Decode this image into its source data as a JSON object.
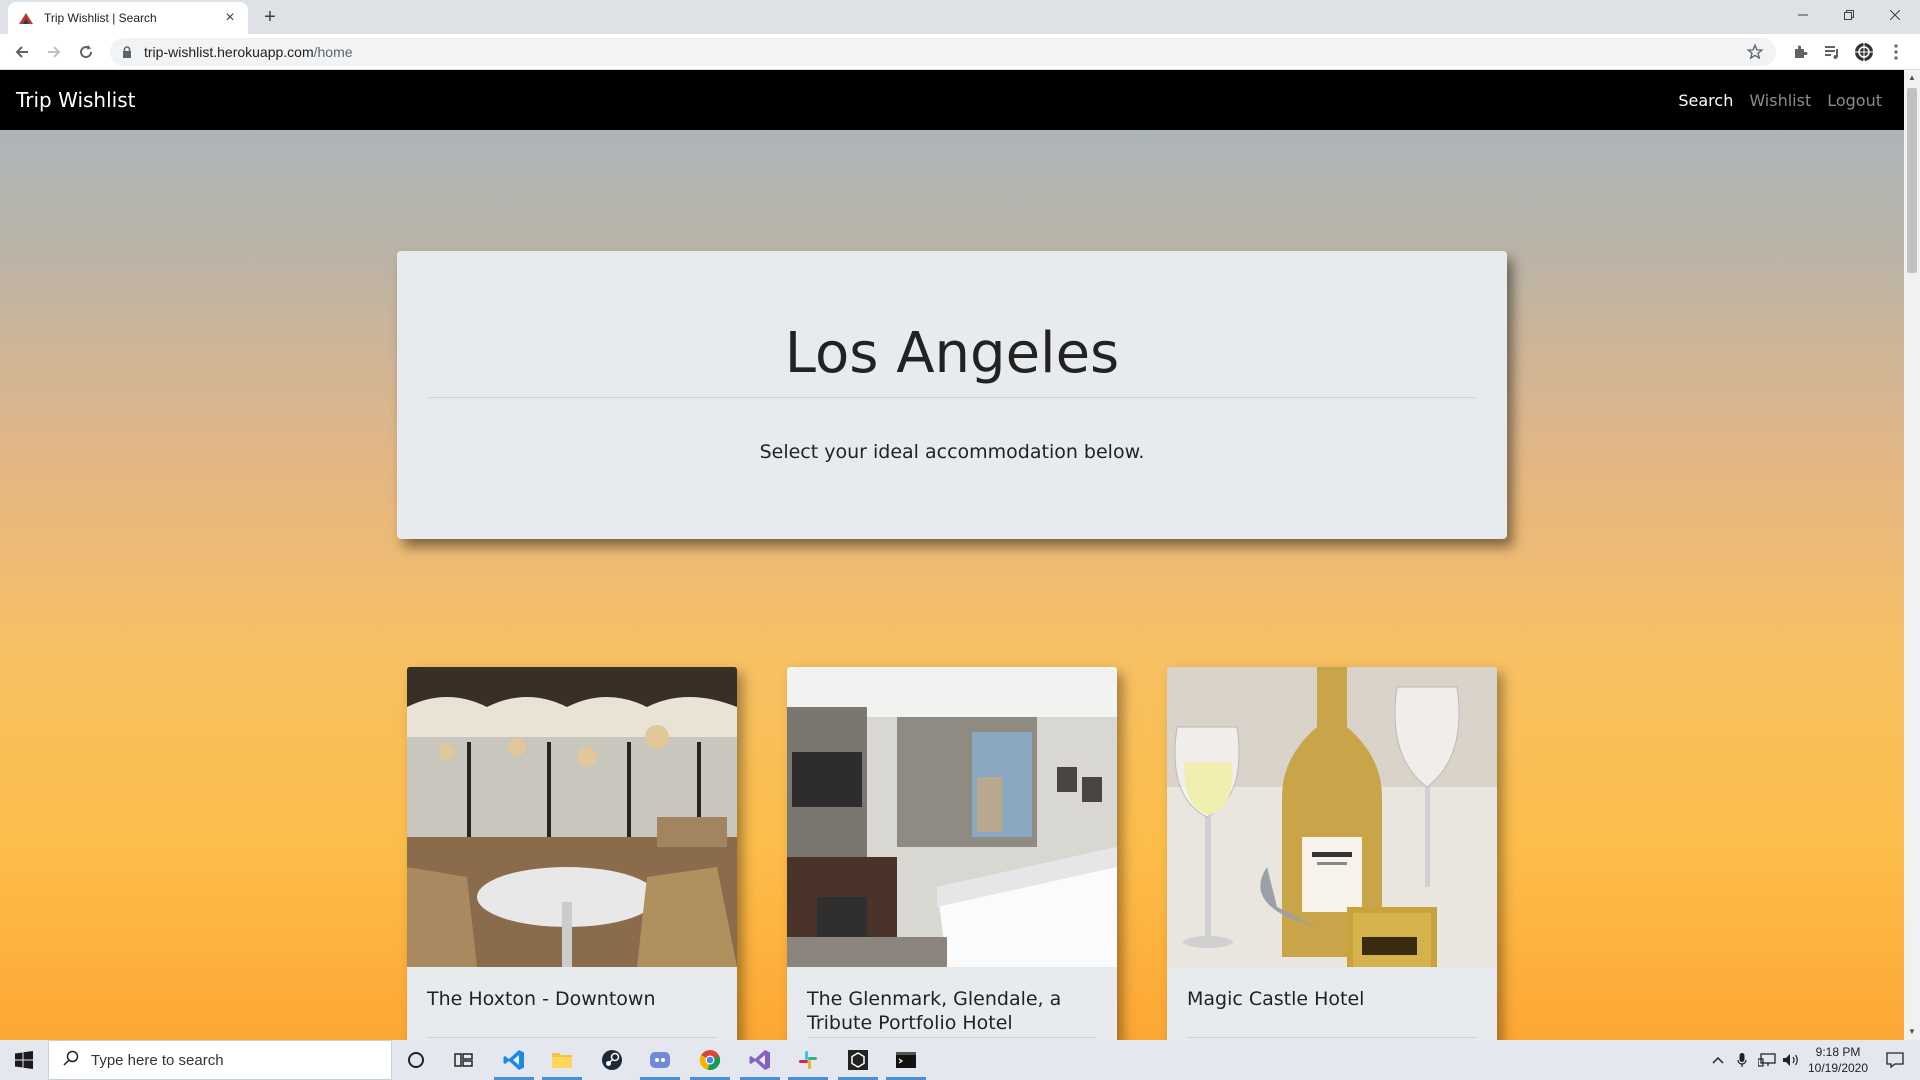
{
  "browser": {
    "tab_title": "Trip Wishlist | Search",
    "url_host": "trip-wishlist.herokuapp.com",
    "url_path": "/home"
  },
  "site": {
    "brand": "Trip Wishlist",
    "nav": [
      "Search",
      "Wishlist",
      "Logout"
    ],
    "active_nav": "Search"
  },
  "hero": {
    "title": "Los Angeles",
    "subtitle": "Select your ideal accommodation below."
  },
  "cards": [
    {
      "title": "The Hoxton - Downtown",
      "image": "restaurant-terrace-photo"
    },
    {
      "title": "The Glenmark, Glendale, a Tribute Portfolio Hotel",
      "image": "hotel-room-photo"
    },
    {
      "title": "Magic Castle Hotel",
      "image": "champagne-bottle-photo"
    }
  ],
  "taskbar": {
    "search_placeholder": "Type here to search",
    "time": "9:18 PM",
    "date": "10/19/2020",
    "apps": [
      "cortana-icon",
      "task-view-icon",
      "vscode-icon",
      "file-explorer-icon",
      "steam-icon",
      "discord-icon",
      "chrome-icon",
      "visual-studio-icon",
      "slack-icon",
      "unity-icon",
      "terminal-icon"
    ]
  }
}
